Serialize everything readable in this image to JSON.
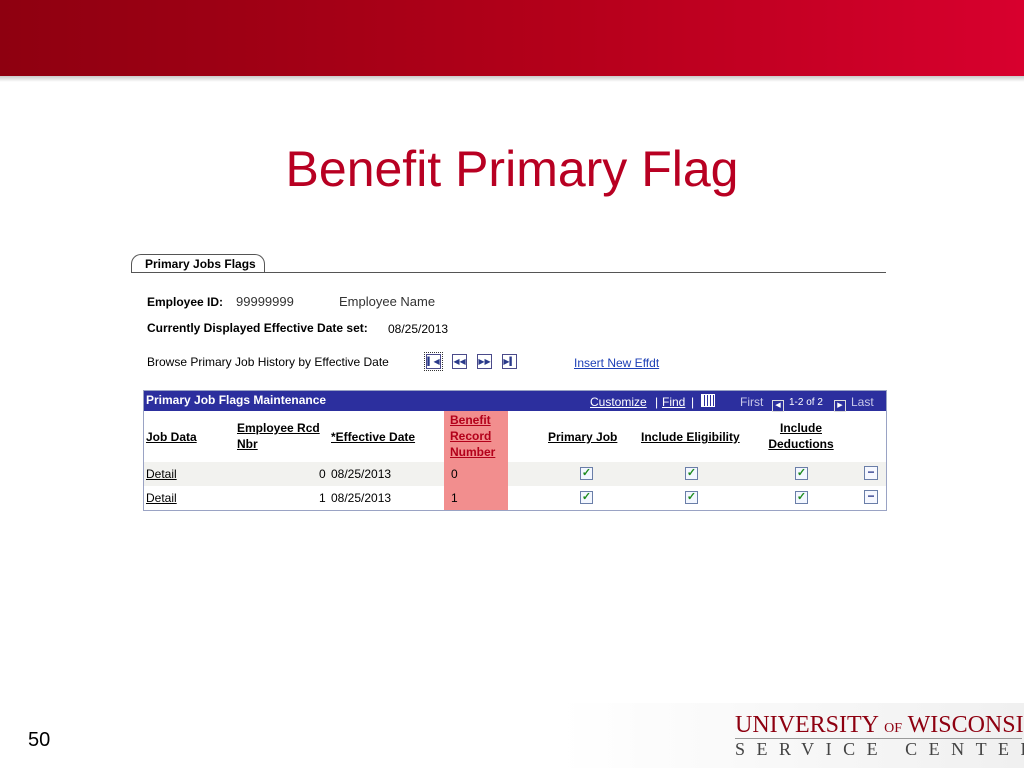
{
  "slide": {
    "title": "Benefit Primary Flag",
    "page_number": "50",
    "logo_line1_a": "UNIVERSITY",
    "logo_line1_of": "OF",
    "logo_line1_b": "WISCONSIN",
    "logo_line2": "SERVICE CENTER"
  },
  "tab": {
    "label": "Primary Jobs Flags"
  },
  "employee": {
    "id_label": "Employee ID:",
    "id_value": "99999999",
    "name_value": "Employee Name",
    "effdt_label": "Currently Displayed Effective Date set:",
    "effdt_value": "08/25/2013"
  },
  "browse": {
    "label": "Browse Primary Job History by Effective Date",
    "insert_link": "Insert New Effdt"
  },
  "grid": {
    "title": "Primary Job Flags Maintenance",
    "customize": "Customize",
    "separator": "|",
    "find": "Find",
    "first": "First",
    "range": "1-2 of 2",
    "last": "Last",
    "headers": {
      "job_data": "Job Data",
      "emp_rcd_1": "Employee Rcd",
      "emp_rcd_2": "Nbr",
      "effdt": "*Effective Date",
      "benefit_1": "Benefit",
      "benefit_2": "Record",
      "benefit_3": "Number",
      "primary_job": "Primary Job",
      "include_eligibility": "Include Eligibility",
      "include_ded_1": "Include",
      "include_ded_2": "Deductions"
    },
    "rows": [
      {
        "job_data": "Detail",
        "emp_rcd": "0",
        "effdt": "08/25/2013",
        "benefit_record": "0",
        "primary_job": true,
        "include_eligibility": true,
        "include_deductions": true
      },
      {
        "job_data": "Detail",
        "emp_rcd": "1",
        "effdt": "08/25/2013",
        "benefit_record": "1",
        "primary_job": true,
        "include_eligibility": true,
        "include_deductions": true
      }
    ]
  },
  "colors": {
    "header_red": "#b4001a",
    "grid_bar": "#2c2f9e",
    "benefit_highlight": "#f28e8e",
    "title_red": "#b80022"
  }
}
